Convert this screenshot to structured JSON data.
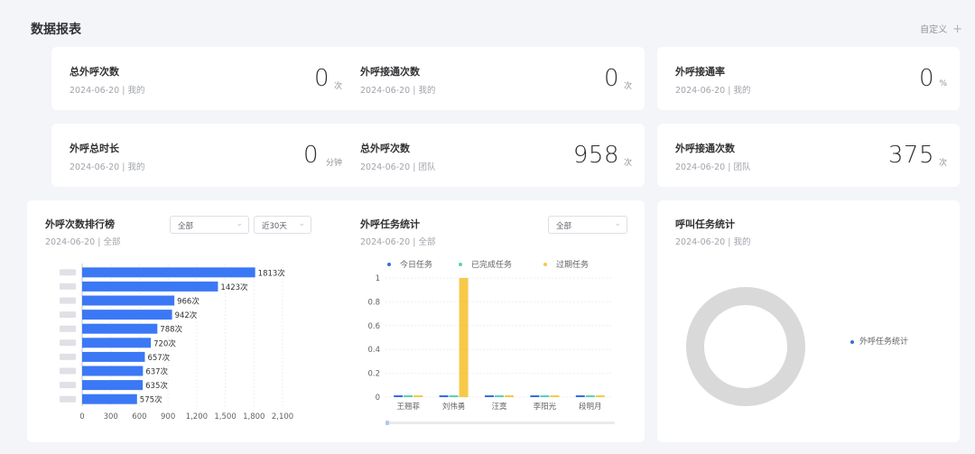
{
  "header": {
    "title": "数据报表",
    "customize_label": "自定义",
    "plus_symbol": "+"
  },
  "stats": [
    {
      "label": "总外呼次数",
      "date": "2024-06-20",
      "scope": "我的",
      "value": "0",
      "unit": "次"
    },
    {
      "label": "外呼接通次数",
      "date": "2024-06-20",
      "scope": "我的",
      "value": "0",
      "unit": "次"
    },
    {
      "label": "外呼接通率",
      "date": "2024-06-20",
      "scope": "我的",
      "value": "0",
      "unit": "%"
    },
    {
      "label": "外呼总时长",
      "date": "2024-06-20",
      "scope": "我的",
      "value": "0",
      "unit": "分钟"
    },
    {
      "label": "总外呼次数",
      "date": "2024-06-20",
      "scope": "团队",
      "value": "958",
      "unit": "次"
    },
    {
      "label": "外呼接通次数",
      "date": "2024-06-20",
      "scope": "团队",
      "value": "375",
      "unit": "次"
    }
  ],
  "ranking_panel": {
    "title": "外呼次数排行榜",
    "subtitle": "2024-06-20 | 全部",
    "filter_scope": "全部",
    "filter_period": "近30天"
  },
  "task_panel": {
    "title": "外呼任务统计",
    "subtitle": "2024-06-20 | 全部",
    "filter_scope": "全部"
  },
  "call_panel": {
    "title": "呼叫任务统计",
    "subtitle": "2024-06-20 | 我的",
    "legend": "外呼任务统计"
  },
  "colors": {
    "bar_blue": "#3b78f6",
    "today": "#3b6bdf",
    "completed": "#5bd1b8",
    "expired": "#f7c94a",
    "ring": "#d9d9d9"
  },
  "chart_data": [
    {
      "type": "bar",
      "orientation": "horizontal",
      "categories": [
        "",
        "",
        "",
        "",
        "",
        "",
        "",
        "",
        "",
        ""
      ],
      "values": [
        1813,
        1423,
        966,
        942,
        788,
        720,
        657,
        637,
        635,
        575
      ],
      "value_suffix": "次",
      "xlim": [
        0,
        2100
      ],
      "xticks": [
        "0",
        "300",
        "600",
        "900",
        "1,200",
        "1,500",
        "1,800",
        "2,100"
      ],
      "grid": true
    },
    {
      "type": "bar",
      "categories": [
        "王翘菲",
        "刘伟勇",
        "汪寞",
        "李阳光",
        "段明月"
      ],
      "series": [
        {
          "name": "今日任务",
          "values": [
            0,
            0,
            0,
            0,
            0
          ]
        },
        {
          "name": "已完成任务",
          "values": [
            0,
            0,
            0,
            0,
            0
          ]
        },
        {
          "name": "过期任务",
          "values": [
            0,
            1,
            0,
            0,
            0
          ]
        }
      ],
      "ylim": [
        0,
        1
      ],
      "yticks": [
        "0",
        "0.2",
        "0.4",
        "0.6",
        "0.8",
        "1"
      ],
      "legend_position": "top",
      "grid": true
    },
    {
      "type": "pie",
      "style": "donut",
      "series": [
        {
          "name": "外呼任务统计",
          "values": [
            0
          ]
        }
      ],
      "legend_position": "right"
    }
  ]
}
